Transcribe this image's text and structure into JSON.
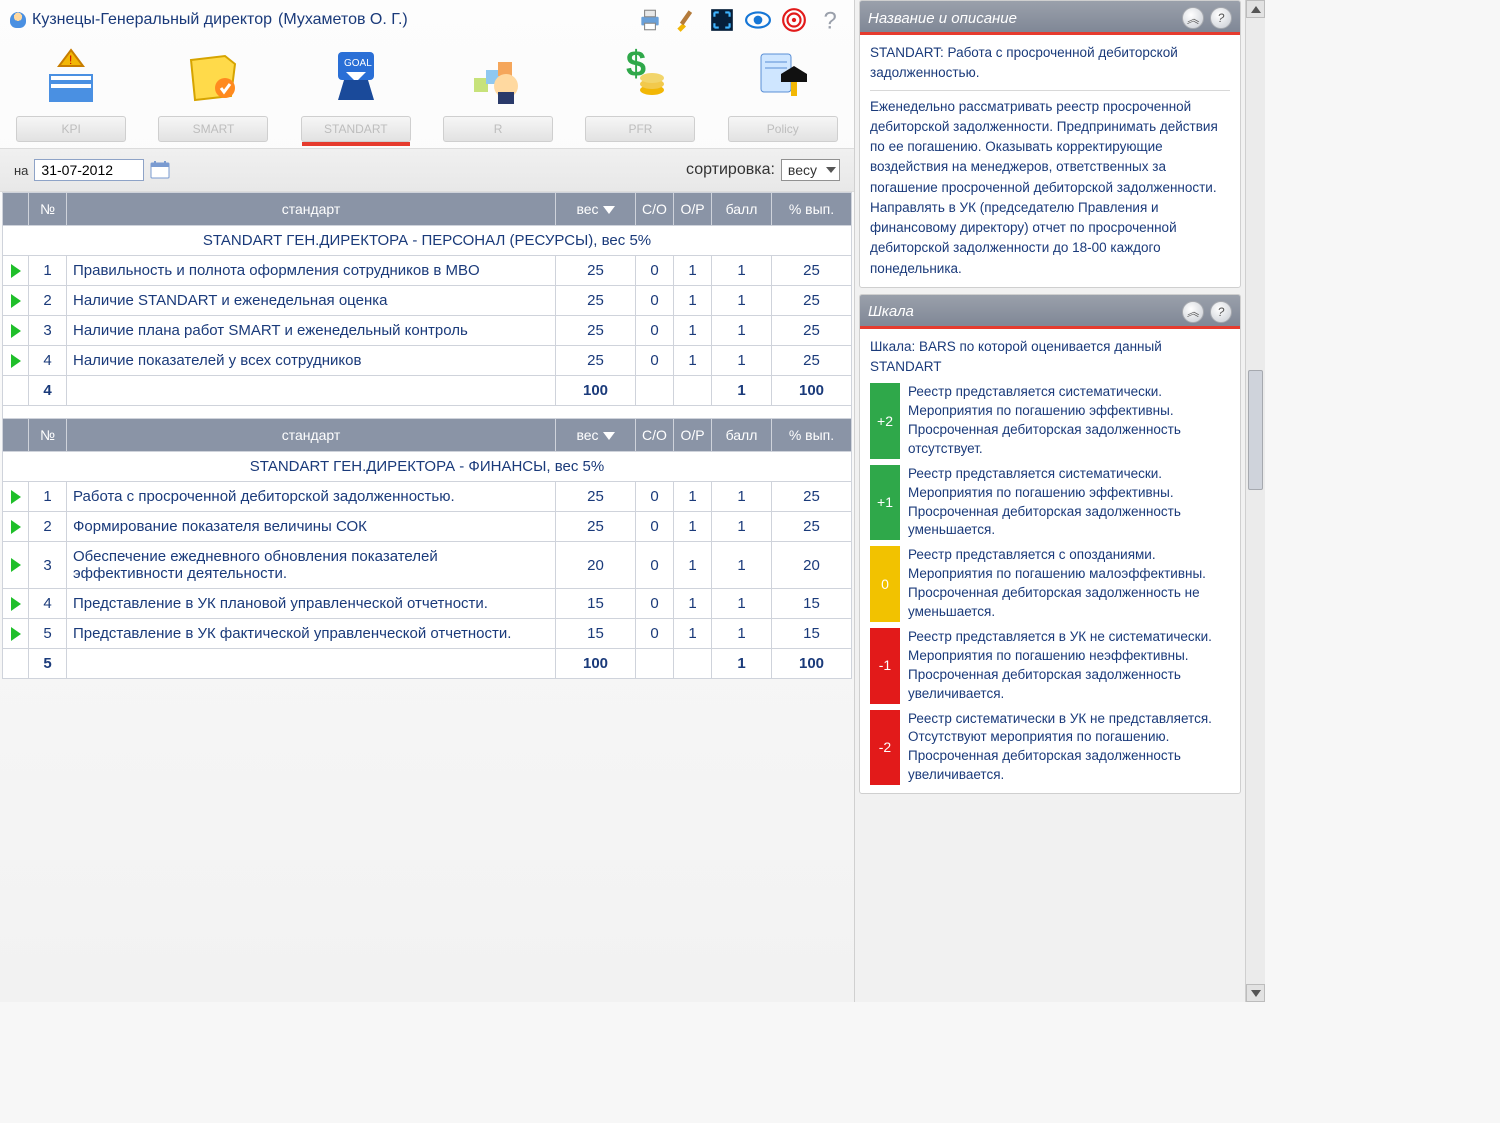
{
  "title": {
    "main": "Кузнецы-Генеральный директор",
    "sub": "(Мухаметов О. Г.)"
  },
  "nav": [
    {
      "key": "kpi",
      "label": "KPI"
    },
    {
      "key": "smart",
      "label": "SMART"
    },
    {
      "key": "standart",
      "label": "STANDART",
      "active": true
    },
    {
      "key": "r",
      "label": "R"
    },
    {
      "key": "pfr",
      "label": "PFR"
    },
    {
      "key": "policy",
      "label": "Policy"
    }
  ],
  "filter": {
    "date_label": "на",
    "date_value": "31-07-2012",
    "sort_label": "сортировка:",
    "sort_value": "весу"
  },
  "table": {
    "cols": {
      "num": "№",
      "standard": "стандарт",
      "weight": "вес",
      "co": "С/О",
      "op": "О/Р",
      "score": "балл",
      "pct": "% вып."
    },
    "groups": [
      {
        "title": "STANDART ГЕН.ДИРЕКТОРА - ПЕРСОНАЛ (РЕСУРСЫ), вес 5%",
        "rows": [
          {
            "n": "1",
            "name": "Правильность и полнота оформления сотрудников в MBO",
            "w": "25",
            "co": "0",
            "op": "1",
            "s": "1",
            "p": "25"
          },
          {
            "n": "2",
            "name": "Наличие STANDART и еженедельная оценка",
            "w": "25",
            "co": "0",
            "op": "1",
            "s": "1",
            "p": "25"
          },
          {
            "n": "3",
            "name": "Наличие плана работ SMART и еженедельный контроль",
            "w": "25",
            "co": "0",
            "op": "1",
            "s": "1",
            "p": "25"
          },
          {
            "n": "4",
            "name": "Наличие показателей у всех сотрудников",
            "w": "25",
            "co": "0",
            "op": "1",
            "s": "1",
            "p": "25"
          }
        ],
        "sum": {
          "count": "4",
          "w": "100",
          "s": "1",
          "p": "100"
        }
      },
      {
        "title": "STANDART ГЕН.ДИРЕКТОРА - ФИНАНСЫ, вес 5%",
        "rows": [
          {
            "n": "1",
            "name": "Работа с просроченной дебиторской задолженностью.",
            "w": "25",
            "co": "0",
            "op": "1",
            "s": "1",
            "p": "25"
          },
          {
            "n": "2",
            "name": "Формирование показателя величины СОК",
            "w": "25",
            "co": "0",
            "op": "1",
            "s": "1",
            "p": "25"
          },
          {
            "n": "3",
            "name": "Обеспечение ежедневного обновления показателей эффективности деятельности.",
            "w": "20",
            "co": "0",
            "op": "1",
            "s": "1",
            "p": "20"
          },
          {
            "n": "4",
            "name": "Представление в УК плановой управленческой отчетности.",
            "w": "15",
            "co": "0",
            "co_red": true,
            "op": "1",
            "s": "1",
            "p": "15"
          },
          {
            "n": "5",
            "name": "Представление в УК фактической управленческой отчетности.",
            "w": "15",
            "co": "0",
            "co_red": true,
            "op": "1",
            "s": "1",
            "p": "15"
          }
        ],
        "sum": {
          "count": "5",
          "w": "100",
          "s": "1",
          "p": "100"
        }
      }
    ]
  },
  "panel_desc": {
    "title": "Название и описание",
    "heading": "STANDART: Работа с просроченной дебиторской задолженностью.",
    "body": "Еженедельно рассматривать реестр просроченной дебиторской задолженности. Предпринимать действия по ее погашению. Оказывать корректирующие воздействия на менеджеров, ответственных за погашение просроченной дебиторской задолженности. Направлять в УК (председателю Правления и финансовому директору) отчет по просроченной дебиторской задолженности до 18-00 каждого понедельника."
  },
  "panel_scale": {
    "title": "Шкала",
    "subtitle": "Шкала: BARS по которой оценивается данный STANDART",
    "bars": [
      {
        "score": "+2",
        "color": "#2fa84a",
        "text": "Реестр представляется систематически. Мероприятия по погашению эффективны. Просроченная дебиторская задолженность отсутствует."
      },
      {
        "score": "+1",
        "color": "#2fa84a",
        "text": "Реестр представляется систематически. Мероприятия по погашению эффективны. Просроченная дебиторская задолженность уменьшается."
      },
      {
        "score": "0",
        "color": "#f2c200",
        "text": "Реестр представляется с опозданиями. Мероприятия по погашению малоэффективны. Просроченная дебиторская задолженность не уменьшается."
      },
      {
        "score": "-1",
        "color": "#e21a1a",
        "text": "Реестр представляется в УК не систематически. Мероприятия по погашению неэффективны. Просроченная дебиторская задолженность увеличивается."
      },
      {
        "score": "-2",
        "color": "#e21a1a",
        "text": "Реестр систематически в УК не представляется. Отсутствуют мероприятия по погашению. Просроченная дебиторская задолженность увеличивается."
      }
    ]
  }
}
